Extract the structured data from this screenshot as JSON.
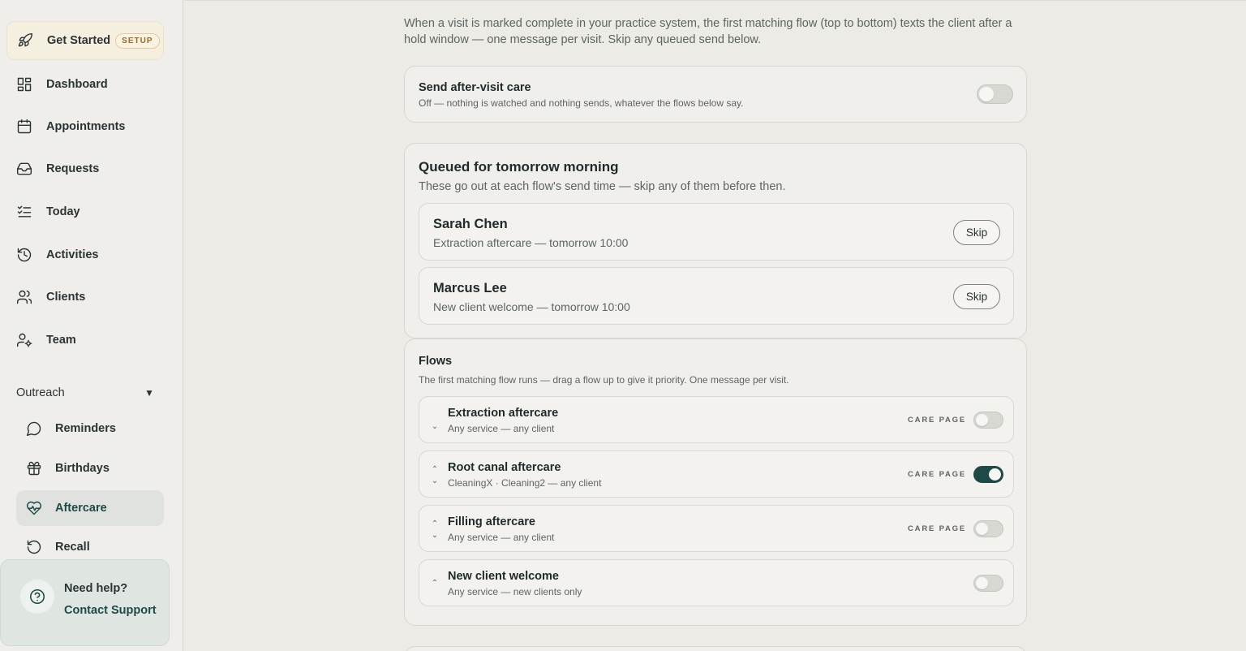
{
  "sidebar": {
    "get_started": {
      "label": "Get Started",
      "badge": "SETUP"
    },
    "items": [
      {
        "label": "Dashboard",
        "icon": "dashboard-icon"
      },
      {
        "label": "Appointments",
        "icon": "calendar-icon"
      },
      {
        "label": "Requests",
        "icon": "inbox-icon"
      },
      {
        "label": "Today",
        "icon": "checklist-icon"
      },
      {
        "label": "Activities",
        "icon": "history-icon"
      },
      {
        "label": "Clients",
        "icon": "users-icon"
      },
      {
        "label": "Team",
        "icon": "user-gear-icon"
      }
    ],
    "outreach": {
      "label": "Outreach",
      "caret": "▼",
      "items": [
        {
          "label": "Reminders",
          "icon": "chat-bubble-icon"
        },
        {
          "label": "Birthdays",
          "icon": "gift-icon"
        },
        {
          "label": "Aftercare",
          "icon": "heart-pulse-icon",
          "active": true
        },
        {
          "label": "Recall",
          "icon": "rotate-icon"
        }
      ]
    },
    "help": {
      "title": "Need help?",
      "link": "Contact Support"
    }
  },
  "main": {
    "intro": "When a visit is marked complete in your practice system, the first matching flow (top to bottom) texts the client after a hold window — one message per visit. Skip any queued send below.",
    "send_card": {
      "title": "Send after-visit care",
      "subtitle": "Off — nothing is watched and nothing sends, whatever the flows below say.",
      "enabled": false
    },
    "queue": {
      "title": "Queued for tomorrow morning",
      "subtitle": "These go out at each flow's send time — skip any of them before then.",
      "skip_label": "Skip",
      "items": [
        {
          "name": "Sarah Chen",
          "detail": "Extraction aftercare — tomorrow 10:00"
        },
        {
          "name": "Marcus Lee",
          "detail": "New client welcome — tomorrow 10:00"
        }
      ]
    },
    "flows": {
      "title": "Flows",
      "subtitle": "The first matching flow runs — drag a flow up to give it priority. One message per visit.",
      "care_label": "CARE PAGE",
      "items": [
        {
          "name": "Extraction aftercare",
          "detail": "Any service — any client",
          "care_page": false
        },
        {
          "name": "Root canal aftercare",
          "detail": "CleaningX · Cleaning2 — any client",
          "care_page": true
        },
        {
          "name": "Filling aftercare",
          "detail": "Any service — any client",
          "care_page": false
        },
        {
          "name": "New client welcome",
          "detail": "Any service — new clients only",
          "care_page": false
        }
      ]
    }
  },
  "colors": {
    "accent": "#1d4a47",
    "setup_badge": "#a0662a",
    "background": "#ecebe6"
  }
}
